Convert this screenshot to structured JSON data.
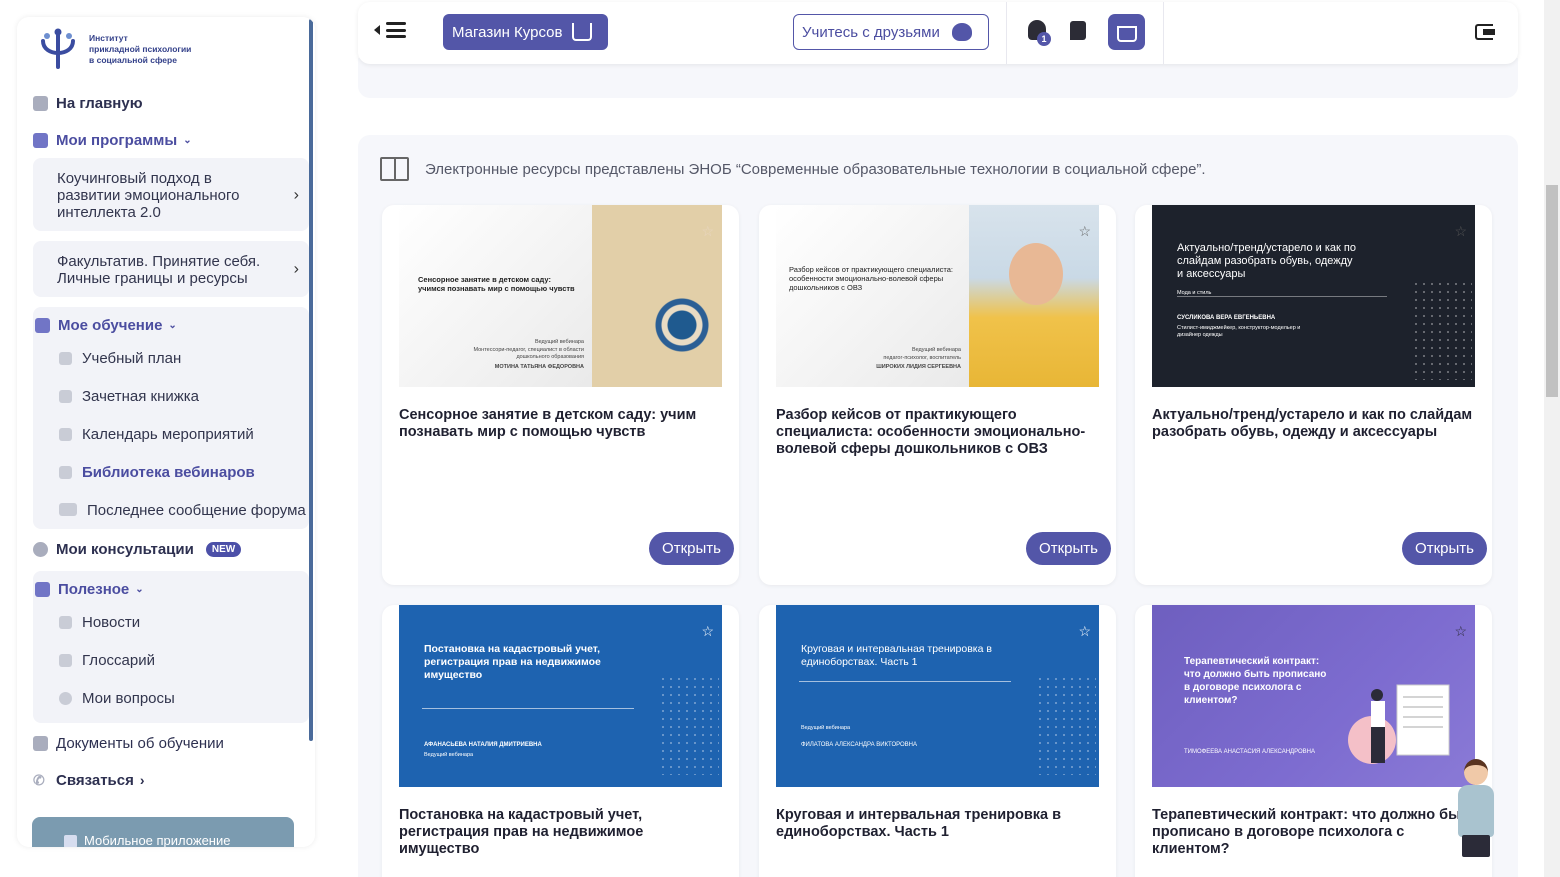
{
  "sidebar": {
    "logo": {
      "line1": "Институт",
      "line2": "прикладной психологии",
      "line3": "в социальной сфере"
    },
    "home": "На главную",
    "my_programs": "Мои программы",
    "programs": [
      "Коучинговый подход в развитии эмоционального интеллекта 2.0",
      "Факультатив. Принятие себя. Личные границы и ресурсы"
    ],
    "my_learning": "Мое обучение",
    "learning_items": [
      "Учебный план",
      "Зачетная книжка",
      "Календарь мероприятий",
      "Библиотека вебинаров",
      "Последнее сообщение форума"
    ],
    "my_consultations": "Мои консультации",
    "badge_new": "NEW",
    "useful": "Полезное",
    "useful_items": [
      "Новости",
      "Глоссарий",
      "Мои вопросы"
    ],
    "documents": "Документы об обучении",
    "contact": "Связаться",
    "mobile_app": "Мобильное приложение"
  },
  "header": {
    "shop_label": "Магазин Курсов",
    "friends_label": "Учитесь с друзьями",
    "notifications_count": "1"
  },
  "main": {
    "notice": "Электронные ресурсы представлены ЭНОБ “Современные образовательные технологии в социальной сфере”.",
    "open_label": "Открыть",
    "cards": [
      {
        "title": "Сенсорное занятие в детском саду: учим познавать мир с помощью чувств",
        "thumb_title": "Сенсорное занятие в детском саду: учимся познавать мир с помощью чувств",
        "thumb_role": "Ведущий вебинара",
        "thumb_desc": "Монтессори-педагог, специалист в области дошкольного образования",
        "thumb_author": "МОТИНА ТАТЬЯНА ФЕДОРОВНА"
      },
      {
        "title": "Разбор кейсов от практикующего специалиста: особенности эмоционально-волевой сферы дошкольников с ОВЗ",
        "thumb_title": "Разбор кейсов от практикующего специалиста: особенности эмоционально-волевой сферы дошкольников с ОВЗ",
        "thumb_role": "Ведущий вебинара",
        "thumb_desc": "педагог-психолог, воспитатель",
        "thumb_author": "ШИРОКИХ ЛИДИЯ СЕРГЕЕВНА"
      },
      {
        "title": "Актуально/тренд/устарело и как по слайдам разобрать обувь, одежду и аксессуары",
        "thumb_title": "Актуально/тренд/устарело и как по слайдам разобрать обувь, одежду и аксессуары",
        "thumb_sub": "Мода и стиль",
        "thumb_author": "СУСЛИКОВА ВЕРА ЕВГЕНЬЕВНА",
        "thumb_desc": "Стилист-имиджмейкер, конструктор-модельер и дизайнер одежды"
      },
      {
        "title": "Постановка на кадастровый учет, регистрация прав на недвижимое имущество",
        "thumb_title": "Постановка на кадастровый учет, регистрация прав на недвижимое имущество",
        "thumb_author": "АФАНАСЬЕВА НАТАЛИЯ ДМИТРИЕВНА",
        "thumb_role": "Ведущий вебинара"
      },
      {
        "title": "Круговая и интервальная тренировка в единоборствах. Часть 1",
        "thumb_title": "Круговая и интервальная тренировка в единоборствах. Часть 1",
        "thumb_role": "Ведущий вебинара",
        "thumb_author": "ФИЛАТОВА АЛЕКСАНДРА ВИКТОРОВНА"
      },
      {
        "title": "Терапевтический контракт: что должно быть прописано в договоре психолога с клиентом?",
        "thumb_title": "Терапевтический контракт: что должно быть прописано в договоре психолога с клиентом?",
        "thumb_author": "ТИМОФЕЕВА АНАСТАСИЯ АЛЕКСАНДРОВНА"
      }
    ]
  },
  "colors": {
    "accent": "#5356a8",
    "sidebar_group_bg": "#f2f3f8",
    "content_bg": "#f6f7fb"
  }
}
